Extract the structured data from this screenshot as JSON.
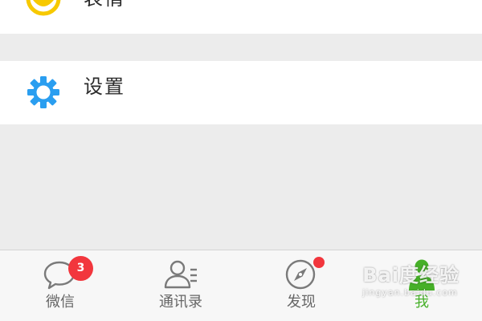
{
  "list": {
    "items": [
      {
        "label": "表情",
        "icon": "emoji-icon",
        "icon_color": "#f7c900"
      },
      {
        "label": "设置",
        "icon": "gear-icon",
        "icon_color": "#2a9ef0"
      }
    ]
  },
  "tabbar": {
    "tabs": [
      {
        "label": "微信",
        "icon": "chat-bubble-icon",
        "badge": "3",
        "active": false
      },
      {
        "label": "通讯录",
        "icon": "contacts-icon",
        "active": false
      },
      {
        "label": "发现",
        "icon": "compass-icon",
        "dot": true,
        "active": false
      },
      {
        "label": "我",
        "icon": "person-icon",
        "active": true
      }
    ],
    "active_color": "#46b028",
    "badge_color": "#f2363d"
  },
  "watermark": {
    "main": "Bai度经验",
    "sub": "jingyan.baidu.com"
  }
}
